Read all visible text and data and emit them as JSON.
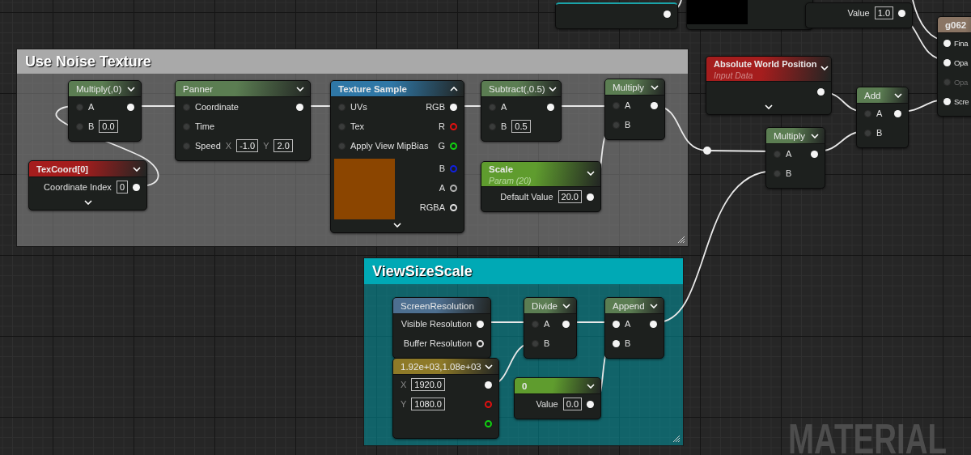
{
  "comments": [
    {
      "title": "Use Noise Texture",
      "kind": "gray"
    },
    {
      "title": "ViewSizeScale",
      "kind": "teal"
    }
  ],
  "nodes": [
    {
      "kind": "teal",
      "rows": [
        {
          "right": [
            {
              "kind": "pin",
              "filled": true
            }
          ]
        }
      ]
    },
    {
      "kind": "plain",
      "preview": {
        "color": "#000000"
      }
    },
    {
      "kind": "plain",
      "rows": [
        {
          "right": [
            {
              "kind": "label",
              "text": "Value"
            },
            {
              "kind": "field",
              "text": "1.0"
            },
            {
              "kind": "pin",
              "filled": true
            }
          ]
        }
      ]
    },
    {
      "kind": "output",
      "title": "g062",
      "rows": [
        {
          "left": [
            {
              "kind": "pin",
              "filled": true
            },
            {
              "kind": "label",
              "text": "Fina",
              "disabled": false
            }
          ]
        },
        {
          "left": [
            {
              "kind": "pin",
              "filled": true
            },
            {
              "kind": "label",
              "text": "Opa",
              "disabled": false
            }
          ]
        },
        {
          "left": [
            {
              "kind": "pin",
              "filled": false
            },
            {
              "kind": "label",
              "text": "Opa",
              "disabled": true
            }
          ]
        },
        {
          "left": [
            {
              "kind": "pin",
              "filled": true
            },
            {
              "kind": "label",
              "text": "Scre",
              "disabled": false
            }
          ]
        }
      ]
    },
    {
      "kind": "math",
      "title": "Multiply(,0)",
      "expanded": false,
      "rows": [
        {
          "left": [
            {
              "kind": "pin",
              "filled": false
            },
            {
              "kind": "label",
              "text": "A"
            }
          ],
          "right": [
            {
              "kind": "pin",
              "filled": true
            }
          ]
        },
        {
          "left": [
            {
              "kind": "pin",
              "filled": false
            },
            {
              "kind": "label",
              "text": "B"
            },
            {
              "kind": "field",
              "text": "0.0"
            }
          ]
        }
      ]
    },
    {
      "kind": "math",
      "title": "Panner",
      "expanded": false,
      "rows": [
        {
          "left": [
            {
              "kind": "pin",
              "filled": false
            },
            {
              "kind": "label",
              "text": "Coordinate"
            }
          ],
          "right": [
            {
              "kind": "pin",
              "filled": true
            }
          ]
        },
        {
          "left": [
            {
              "kind": "pin",
              "filled": false
            },
            {
              "kind": "label",
              "text": "Time"
            }
          ]
        },
        {
          "left": [
            {
              "kind": "pin",
              "filled": false
            },
            {
              "kind": "label",
              "text": "Speed"
            },
            {
              "kind": "axis",
              "text": "X"
            },
            {
              "kind": "field",
              "text": "-1.0"
            },
            {
              "kind": "axis",
              "text": "Y"
            },
            {
              "kind": "field",
              "text": "2.0"
            }
          ]
        }
      ]
    },
    {
      "kind": "texture",
      "title": "Texture Sample",
      "expanded": true,
      "footer": true,
      "rows": [
        {
          "left": [
            {
              "kind": "pin",
              "filled": false
            },
            {
              "kind": "label",
              "text": "UVs"
            }
          ],
          "right": [
            {
              "kind": "label",
              "text": "RGB"
            },
            {
              "kind": "pin",
              "filled": true
            }
          ]
        },
        {
          "left": [
            {
              "kind": "pin",
              "filled": false
            },
            {
              "kind": "label",
              "text": "Tex"
            }
          ],
          "right": [
            {
              "kind": "label",
              "text": "R"
            },
            {
              "kind": "pin",
              "filled": false,
              "color": "#e01010"
            }
          ]
        },
        {
          "left": [
            {
              "kind": "pin",
              "filled": false
            },
            {
              "kind": "label",
              "text": "Apply View MipBias"
            }
          ],
          "right": [
            {
              "kind": "label",
              "text": "G"
            },
            {
              "kind": "pin",
              "filled": false,
              "color": "#10d010"
            }
          ]
        }
      ],
      "preview": {
        "color": "#8b4500",
        "rows": [
          {
            "right": [
              {
                "kind": "label",
                "text": "B"
              },
              {
                "kind": "pin",
                "filled": false,
                "color": "#1020e0"
              }
            ]
          },
          {
            "right": [
              {
                "kind": "label",
                "text": "A"
              },
              {
                "kind": "pin",
                "filled": false,
                "color": "#b0b0b0"
              }
            ]
          },
          {
            "right": [
              {
                "kind": "label",
                "text": "RGBA"
              },
              {
                "kind": "pin",
                "filled": false
              }
            ]
          }
        ]
      }
    },
    {
      "kind": "input",
      "title": "TexCoord[0]",
      "expanded": false,
      "footer": true,
      "rows": [
        {
          "right": [
            {
              "kind": "label",
              "text": "Coordinate Index"
            },
            {
              "kind": "field",
              "text": "0"
            },
            {
              "kind": "pin",
              "filled": true
            }
          ]
        }
      ]
    },
    {
      "kind": "math",
      "title": "Subtract(,0.5)",
      "expanded": false,
      "rows": [
        {
          "left": [
            {
              "kind": "pin",
              "filled": false
            },
            {
              "kind": "label",
              "text": "A"
            }
          ],
          "right": [
            {
              "kind": "pin",
              "filled": true
            }
          ]
        },
        {
          "left": [
            {
              "kind": "pin",
              "filled": false
            },
            {
              "kind": "label",
              "text": "B"
            },
            {
              "kind": "field",
              "text": "0.5"
            }
          ]
        }
      ]
    },
    {
      "kind": "math",
      "title": "Multiply",
      "expanded": false,
      "rows": [
        {
          "left": [
            {
              "kind": "pin",
              "filled": false
            },
            {
              "kind": "label",
              "text": "A"
            }
          ],
          "right": [
            {
              "kind": "pin",
              "filled": true
            }
          ]
        },
        {
          "left": [
            {
              "kind": "pin",
              "filled": false
            },
            {
              "kind": "label",
              "text": "B"
            }
          ]
        }
      ]
    },
    {
      "kind": "param",
      "title": "Scale",
      "subtitle": "Param (20)",
      "expanded": false,
      "rows": [
        {
          "right": [
            {
              "kind": "label",
              "text": "Default Value"
            },
            {
              "kind": "field",
              "text": "20.0"
            },
            {
              "kind": "pin",
              "filled": true
            }
          ]
        }
      ]
    },
    {
      "kind": "input",
      "title": "Absolute World Position",
      "subtitle": "Input Data",
      "expanded": false,
      "footer": true,
      "rows": [
        {
          "right": [
            {
              "kind": "pin",
              "filled": true
            }
          ]
        }
      ]
    },
    {
      "kind": "math",
      "title": "Multiply",
      "expanded": false,
      "rows": [
        {
          "left": [
            {
              "kind": "pin",
              "filled": false
            },
            {
              "kind": "label",
              "text": "A"
            }
          ],
          "right": [
            {
              "kind": "pin",
              "filled": true
            }
          ]
        },
        {
          "left": [
            {
              "kind": "pin",
              "filled": false
            },
            {
              "kind": "label",
              "text": "B"
            }
          ]
        }
      ]
    },
    {
      "kind": "math",
      "title": "Add",
      "expanded": false,
      "rows": [
        {
          "left": [
            {
              "kind": "pin",
              "filled": false
            },
            {
              "kind": "label",
              "text": "A"
            }
          ],
          "right": [
            {
              "kind": "pin",
              "filled": true
            }
          ]
        },
        {
          "left": [
            {
              "kind": "pin",
              "filled": false
            },
            {
              "kind": "label",
              "text": "B"
            }
          ]
        }
      ]
    },
    {
      "kind": "screen",
      "title": "ScreenResolution",
      "rows": [
        {
          "right": [
            {
              "kind": "label",
              "text": "Visible Resolution"
            },
            {
              "kind": "pin",
              "filled": true
            }
          ]
        },
        {
          "right": [
            {
              "kind": "label",
              "text": "Buffer Resolution"
            },
            {
              "kind": "pin",
              "filled": false
            }
          ]
        }
      ]
    },
    {
      "kind": "vector",
      "title": "1.92e+03,1.08e+03",
      "expanded": false,
      "rows": [
        {
          "left": [
            {
              "kind": "axis",
              "text": "X"
            },
            {
              "kind": "field",
              "text": "1920.0"
            }
          ],
          "right": [
            {
              "kind": "pin",
              "filled": true
            }
          ]
        },
        {
          "left": [
            {
              "kind": "axis",
              "text": "Y"
            },
            {
              "kind": "field",
              "text": "1080.0"
            }
          ],
          "right": [
            {
              "kind": "pin",
              "filled": false,
              "color": "#e01010"
            }
          ]
        },
        {
          "right": [
            {
              "kind": "pin",
              "filled": false,
              "color": "#10d010"
            }
          ]
        }
      ]
    },
    {
      "kind": "math",
      "title": "Divide",
      "expanded": false,
      "rows": [
        {
          "left": [
            {
              "kind": "pin",
              "filled": false
            },
            {
              "kind": "label",
              "text": "A"
            }
          ],
          "right": [
            {
              "kind": "pin",
              "filled": true
            }
          ]
        },
        {
          "left": [
            {
              "kind": "pin",
              "filled": false
            },
            {
              "kind": "label",
              "text": "B"
            }
          ]
        }
      ]
    },
    {
      "kind": "math",
      "title": "Append",
      "expanded": false,
      "rows": [
        {
          "left": [
            {
              "kind": "pin",
              "filled": true
            },
            {
              "kind": "label",
              "text": "A"
            }
          ],
          "right": [
            {
              "kind": "pin",
              "filled": true
            }
          ]
        },
        {
          "left": [
            {
              "kind": "pin",
              "filled": true
            },
            {
              "kind": "label",
              "text": "B"
            }
          ]
        }
      ]
    },
    {
      "kind": "param",
      "title": "0",
      "expanded": false,
      "rows": [
        {
          "right": [
            {
              "kind": "label",
              "text": "Value"
            },
            {
              "kind": "field",
              "text": "0.0"
            },
            {
              "kind": "pin",
              "filled": true
            }
          ]
        }
      ]
    }
  ],
  "graph_watermark": "MATERIAL"
}
